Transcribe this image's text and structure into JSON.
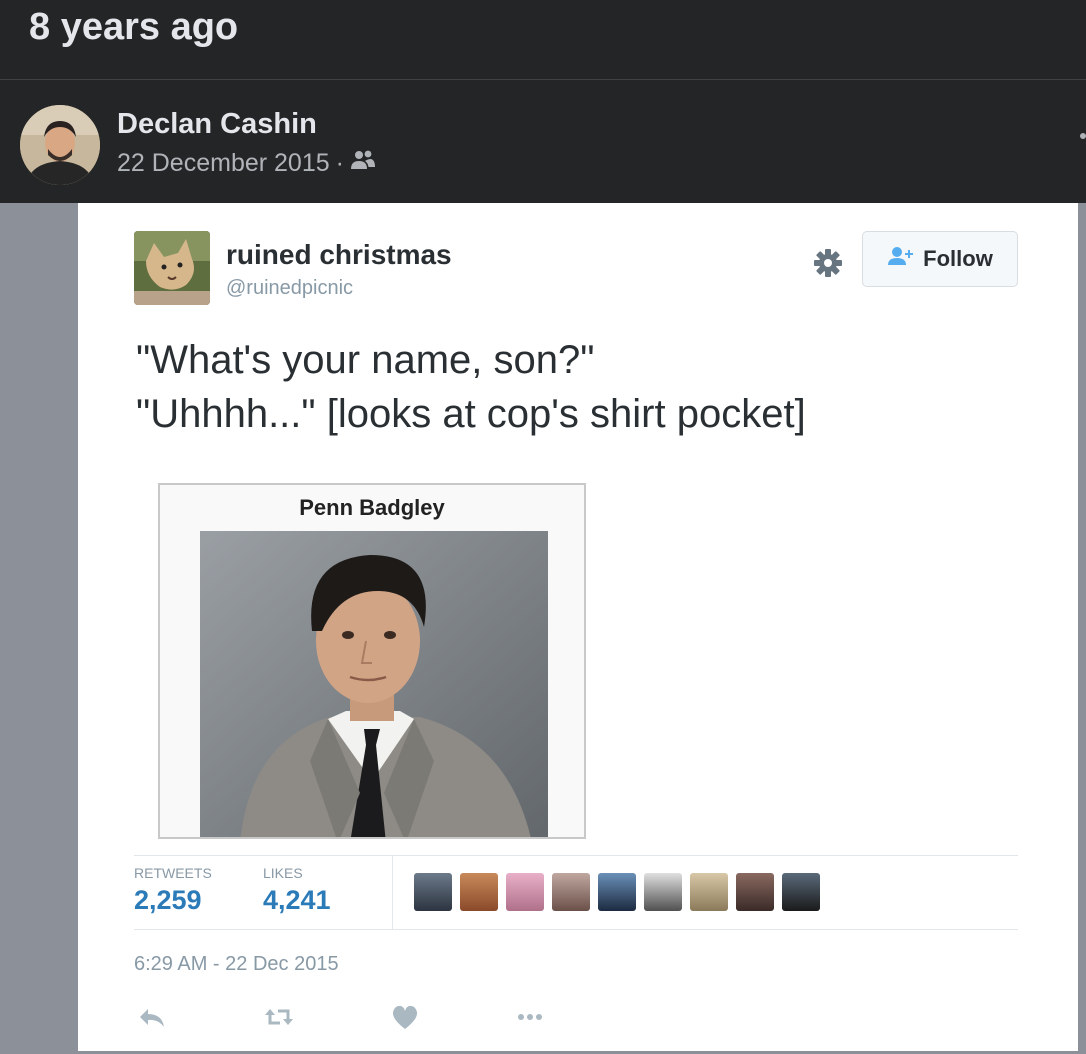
{
  "memory": {
    "title": "8 years ago"
  },
  "post": {
    "author": "Declan Cashin",
    "date": "22 December 2015",
    "separator": "·",
    "audience_icon": "friends-icon"
  },
  "tweet": {
    "name": "ruined christmas",
    "handle": "@ruinedpicnic",
    "follow_label": "Follow",
    "text_lines": [
      "\"What's your name, son?\"",
      "\"Uhhhh...\" [looks at cop's shirt pocket]"
    ],
    "media_caption": "Penn Badgley",
    "stats": {
      "retweets_label": "RETWEETS",
      "retweets_value": "2,259",
      "likes_label": "LIKES",
      "likes_value": "4,241"
    },
    "timestamp": "6:29 AM - 22 Dec 2015",
    "actions": [
      "reply-icon",
      "retweet-icon",
      "heart-icon",
      "more-icon"
    ]
  },
  "colors": {
    "dark_bg": "#242526",
    "link_blue": "#2b7bb9",
    "muted": "#8899a6"
  }
}
